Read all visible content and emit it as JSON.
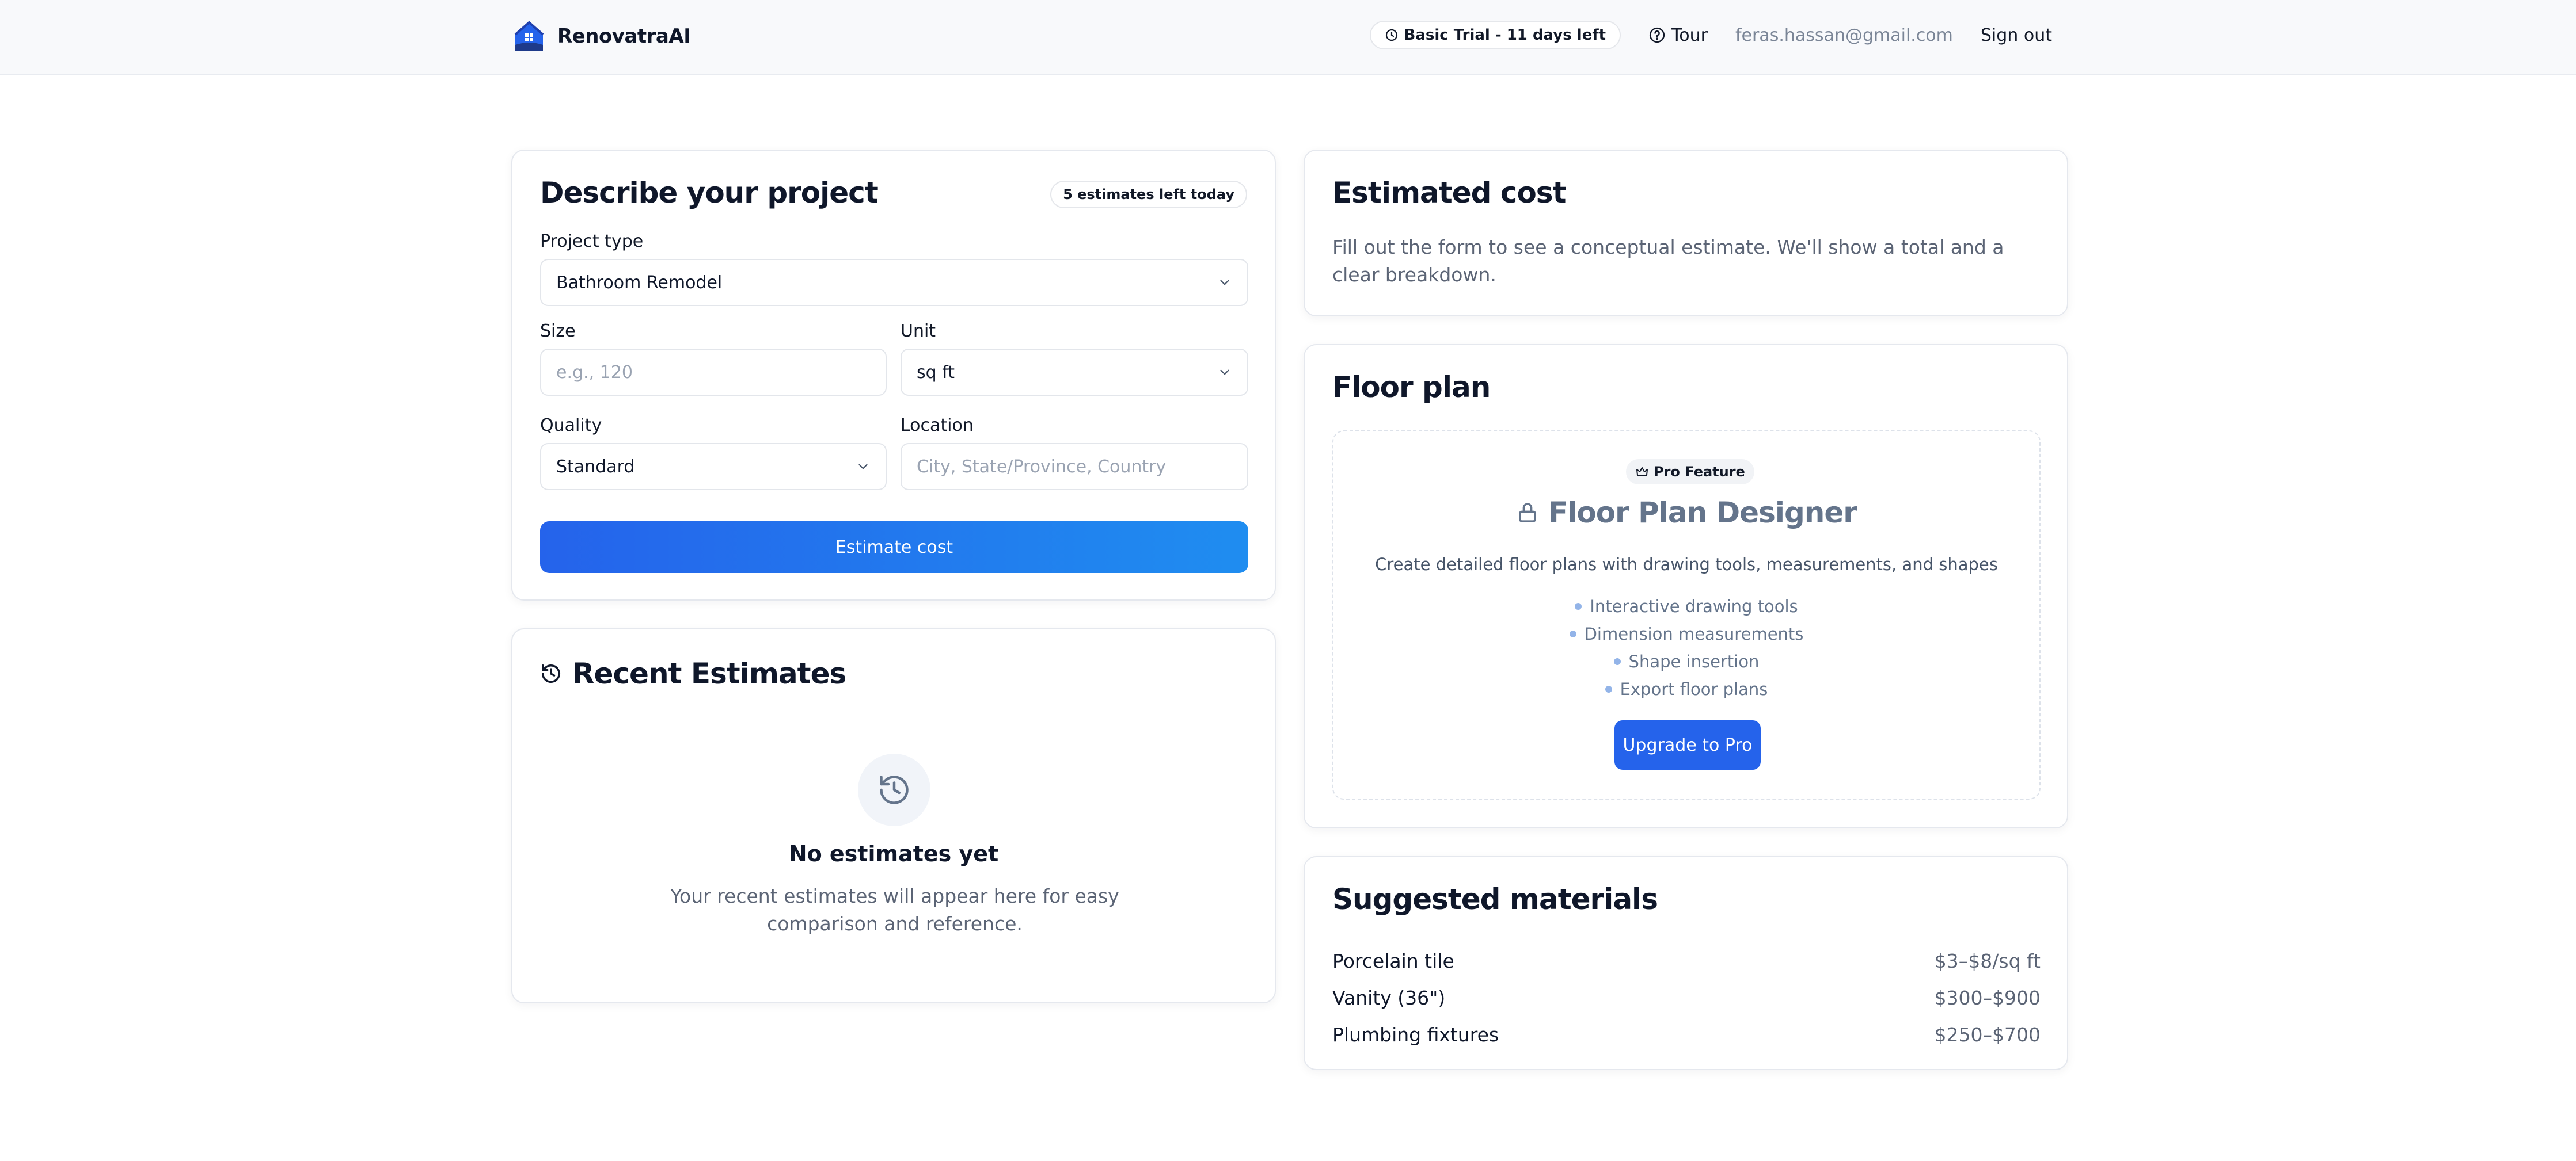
{
  "header": {
    "brand": "RenovatraAI",
    "trial_badge": "Basic Trial - 11 days left",
    "tour_label": "Tour",
    "email": "feras.hassan@gmail.com",
    "signout_label": "Sign out"
  },
  "describe": {
    "title": "Describe your project",
    "estimates_left": "5 estimates left today",
    "project_type_label": "Project type",
    "project_type_value": "Bathroom Remodel",
    "size_label": "Size",
    "size_placeholder": "e.g., 120",
    "unit_label": "Unit",
    "unit_value": "sq ft",
    "quality_label": "Quality",
    "quality_value": "Standard",
    "location_label": "Location",
    "location_placeholder": "City, State/Province, Country",
    "submit_label": "Estimate cost"
  },
  "recent": {
    "title": "Recent Estimates",
    "empty_title": "No estimates yet",
    "empty_desc": "Your recent estimates will appear here for easy comparison and reference."
  },
  "cost": {
    "title": "Estimated cost",
    "desc": "Fill out the form to see a conceptual estimate. We'll show a total and a clear breakdown."
  },
  "floor_plan": {
    "title": "Floor plan",
    "pro_badge": "Pro Feature",
    "designer_title": "Floor Plan Designer",
    "desc": "Create detailed floor plans with drawing tools, measurements, and shapes",
    "features": [
      "Interactive drawing tools",
      "Dimension measurements",
      "Shape insertion",
      "Export floor plans"
    ],
    "upgrade_label": "Upgrade to Pro"
  },
  "materials": {
    "title": "Suggested materials",
    "items": [
      {
        "name": "Porcelain tile",
        "price": "$3–$8/sq ft"
      },
      {
        "name": "Vanity (36\")",
        "price": "$300–$900"
      },
      {
        "name": "Plumbing fixtures",
        "price": "$250–$700"
      }
    ]
  },
  "colors": {
    "accent": "#2563eb",
    "accent_gradient_end": "#1f8df0",
    "muted_text": "#5b6475"
  },
  "icons": {
    "logo": "house-logo-icon",
    "trial": "clock-icon",
    "tour": "help-circle-icon",
    "recent": "history-icon",
    "pro": "crown-icon",
    "designer": "lock-icon",
    "select": "chevron-down-icon"
  }
}
